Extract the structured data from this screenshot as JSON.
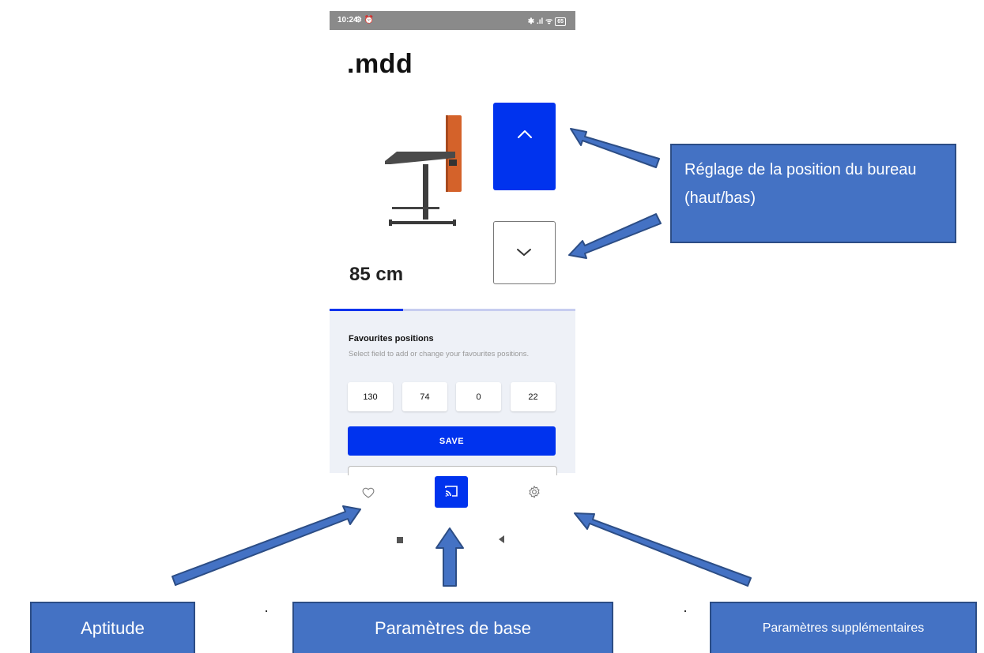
{
  "status_bar": {
    "time": "10:24",
    "left_icons": "⚙ ⏰",
    "right_icons": "✱ .ıl ᯤ",
    "battery": "65"
  },
  "app": {
    "logo": ".mdd",
    "height_readout": "85 cm",
    "progress_fraction": 0.3,
    "favourites": {
      "title": "Favourites positions",
      "description": "Select field to add or change your favourites positions.",
      "positions": [
        "130",
        "74",
        "0",
        "22"
      ],
      "save_label": "SAVE"
    },
    "nav": {
      "items": [
        {
          "name": "heart-icon"
        },
        {
          "name": "cast-icon",
          "active": true
        },
        {
          "name": "gear-icon"
        }
      ]
    }
  },
  "annotations": {
    "adjust": "Réglage de la position du bureau (haut/bas)",
    "aptitude": "Aptitude",
    "base": "Paramètres de base",
    "extra": "Paramètres supplémentaires"
  },
  "colors": {
    "accent": "#0033ee",
    "callout": "#4472c4",
    "callout_border": "#2c4d85",
    "desk_panel": "#d4622a",
    "panel_bg": "#eef1f7"
  }
}
